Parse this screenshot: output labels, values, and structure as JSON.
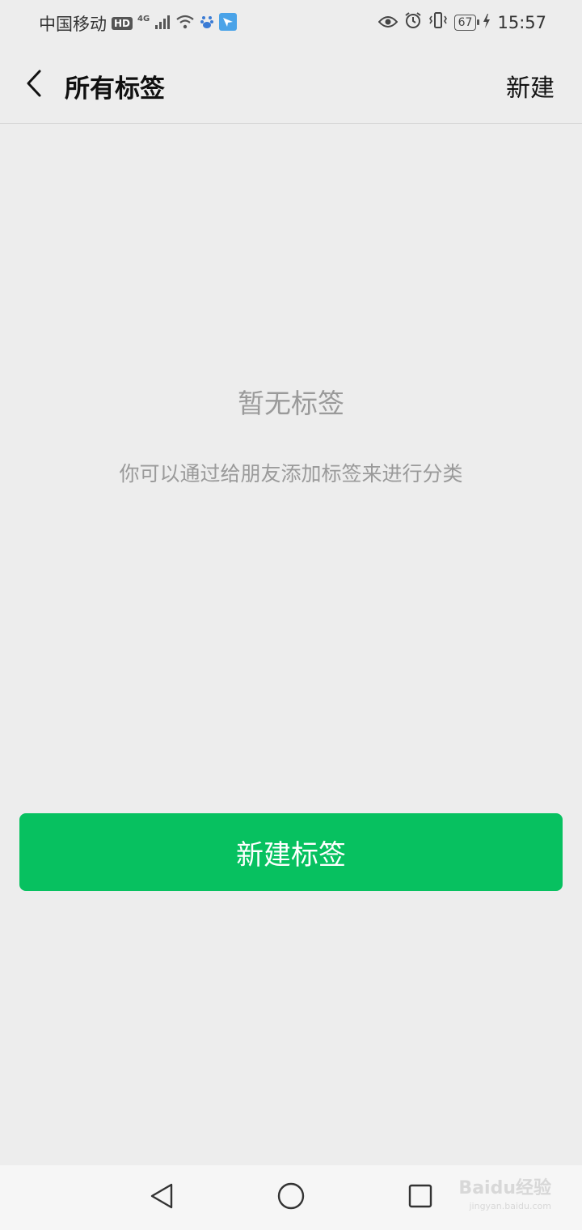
{
  "status_bar": {
    "carrier": "中国移动",
    "hd_badge": "HD",
    "network": "4G",
    "battery": "67",
    "time": "15:57",
    "icons": [
      "signal-icon",
      "wifi-icon",
      "baidu-app-icon",
      "app-notification-icon",
      "eye-icon",
      "alarm-icon",
      "vibrate-icon",
      "charging-icon"
    ]
  },
  "header": {
    "title": "所有标签",
    "new_label": "新建"
  },
  "empty_state": {
    "title": "暂无标签",
    "description": "你可以通过给朋友添加标签来进行分类"
  },
  "create_button": {
    "label": "新建标签",
    "color": "#07c160"
  },
  "watermark": {
    "text": "Baidu经验",
    "sub": "jingyan.baidu.com"
  }
}
